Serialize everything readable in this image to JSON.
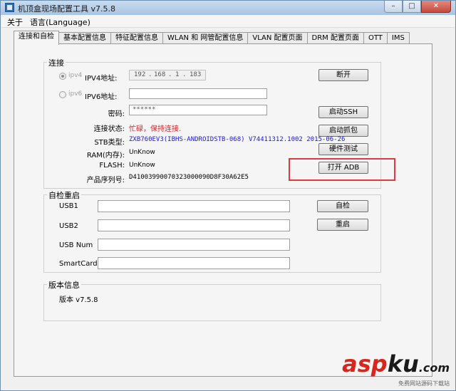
{
  "window": {
    "title": "机顶盒现场配置工具 v7.5.8"
  },
  "menu": [
    "关于",
    "语言(Language)"
  ],
  "tabs": [
    {
      "label": "连接和自检",
      "active": true
    },
    {
      "label": "基本配置信息"
    },
    {
      "label": "特征配置信息"
    },
    {
      "label": "WLAN 和 网管配置信息"
    },
    {
      "label": "VLAN 配置页面"
    },
    {
      "label": "DRM 配置页面"
    },
    {
      "label": "OTT"
    },
    {
      "label": "IMS"
    }
  ],
  "connection": {
    "group_title": "连接",
    "ipv4_radio": "ipv4",
    "ipv4_label": "IPV4地址:",
    "ipv4_octets": [
      "192",
      "168",
      "1",
      "183"
    ],
    "ipv6_radio": "ipv6",
    "ipv6_label": "IPV6地址:",
    "ipv6_value": "",
    "password_label": "密码:",
    "password_value": "******",
    "status_label": "连接状态:",
    "status_value": "忙碌，保持连接.",
    "stb_type_label": "STB类型:",
    "stb_type_value": "ZXB760EV3(IBHS-ANDROIDSTB-068) V74411312.1002 2015-06-26",
    "ram_label": "RAM(内存):",
    "ram_value": "UnKnow",
    "flash_label": "FLASH:",
    "flash_value": "UnKnow",
    "serial_label": "产品序列号:",
    "serial_value": "D41003990070323000090D8F30A62E5",
    "buttons": {
      "disconnect": "断开",
      "start_ssh": "启动SSH",
      "start_capture": "启动抓包",
      "hardware_test": "硬件测试",
      "open_adb": "打开 ADB"
    }
  },
  "selftest": {
    "group_title": "自检重启",
    "usb1_label": "USB1",
    "usb2_label": "USB2",
    "usbnum_label": "USB Num",
    "smartcard_label": "SmartCard",
    "selfcheck_button": "自检",
    "reboot_button": "重启"
  },
  "version": {
    "group_title": "版本信息",
    "text": "版本 v7.5.8"
  },
  "watermark": {
    "asp": "asp",
    "ku": "ku",
    "com": ".com",
    "sub": "免费网站源码下载站"
  },
  "colors": {
    "status_red": "#e02020",
    "stb_blue": "#1a1ad0",
    "highlight_red": "#e03a3a"
  }
}
